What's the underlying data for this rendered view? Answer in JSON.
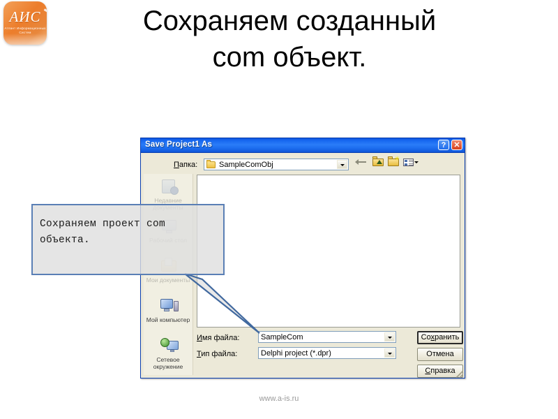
{
  "slide": {
    "title": "Сохраняем созданный\ncom объект.",
    "footer": "www.a-is.ru"
  },
  "logo": {
    "mark": "АИС",
    "subtitle": "Атлант\nИнформационных\nСистем",
    "color": "#ec7d2b"
  },
  "callout": {
    "text": "Сохраняем проект com\nобъекта.",
    "border_color": "#5a7fb5",
    "fill_color": "#dedede"
  },
  "dialog": {
    "title": "Save Project1 As",
    "titlebar_color": "#1666ef",
    "body_color": "#ece9d8",
    "titlebar_buttons": [
      {
        "name": "help",
        "glyph": "?"
      },
      {
        "name": "close",
        "glyph": "✕"
      }
    ],
    "lookin": {
      "label": "Папка:",
      "label_accel": "П",
      "label_rest": "апка:",
      "value": "SampleComObj"
    },
    "toolbar": [
      {
        "name": "back-icon",
        "tooltip": "Назад"
      },
      {
        "name": "up-folder-icon",
        "tooltip": "Вверх"
      },
      {
        "name": "new-folder-icon",
        "tooltip": "Создать папку"
      },
      {
        "name": "views-icon",
        "tooltip": "Вид"
      }
    ],
    "places": [
      {
        "label": "Недавние\nдокументы",
        "icon": "recent-documents-icon",
        "dim": true
      },
      {
        "label": "Рабочий стол",
        "icon": "desktop-icon",
        "dim": true
      },
      {
        "label": "Мои документы",
        "icon": "my-documents-icon",
        "dim": true
      },
      {
        "label": "Мой компьютер",
        "icon": "my-computer-icon",
        "dim": false
      },
      {
        "label": "Сетевое\nокружение",
        "icon": "network-places-icon",
        "dim": false
      }
    ],
    "file_list": {
      "items": []
    },
    "fields": [
      {
        "name": "file-name",
        "label_accel": "И",
        "label_rest": "мя файла:",
        "value": "SampleCom"
      },
      {
        "name": "file-type",
        "label_accel": "Т",
        "label_rest": "ип файла:",
        "value": "Delphi project (*.dpr)"
      }
    ],
    "buttons": [
      {
        "name": "save",
        "accel": "х",
        "before": "Со",
        "after": "ранить",
        "default": true
      },
      {
        "name": "cancel",
        "accel": "",
        "before": "Отмена",
        "after": "",
        "default": false
      },
      {
        "name": "help",
        "accel": "С",
        "before": "",
        "after": "правка",
        "default": false
      }
    ]
  }
}
